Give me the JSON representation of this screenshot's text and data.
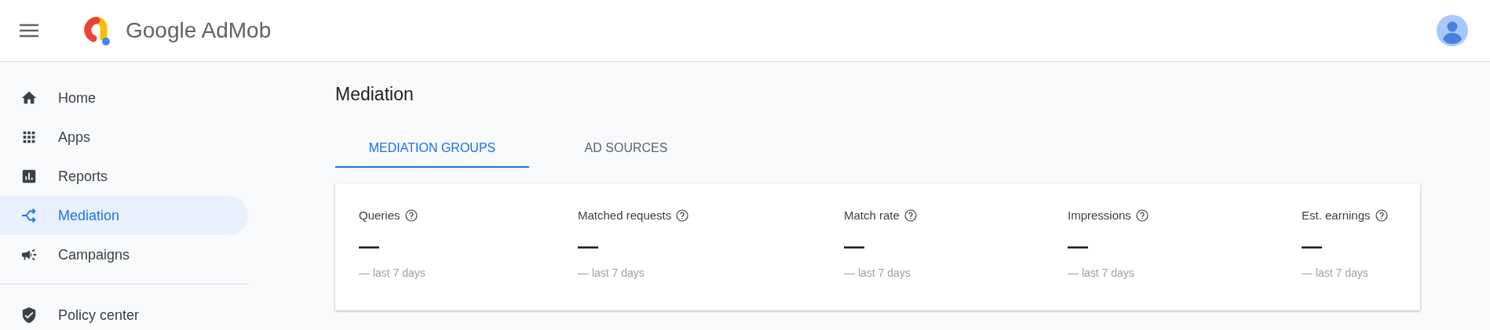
{
  "header": {
    "brand": "Google AdMob"
  },
  "sidebar": {
    "items": [
      {
        "label": "Home",
        "selected": false
      },
      {
        "label": "Apps",
        "selected": false
      },
      {
        "label": "Reports",
        "selected": false
      },
      {
        "label": "Mediation",
        "selected": true
      },
      {
        "label": "Campaigns",
        "selected": false
      }
    ],
    "footer_items": [
      {
        "label": "Policy center",
        "selected": false
      }
    ]
  },
  "page": {
    "title": "Mediation"
  },
  "tabs": [
    {
      "label": "MEDIATION GROUPS",
      "selected": true
    },
    {
      "label": "AD SOURCES",
      "selected": false
    }
  ],
  "metrics": [
    {
      "label": "Queries",
      "value": "—",
      "period": "— last 7 days"
    },
    {
      "label": "Matched requests",
      "value": "—",
      "period": "— last 7 days"
    },
    {
      "label": "Match rate",
      "value": "—",
      "period": "— last 7 days"
    },
    {
      "label": "Impressions",
      "value": "—",
      "period": "— last 7 days"
    },
    {
      "label": "Est. earnings",
      "value": "—",
      "period": "— last 7 days"
    }
  ]
}
